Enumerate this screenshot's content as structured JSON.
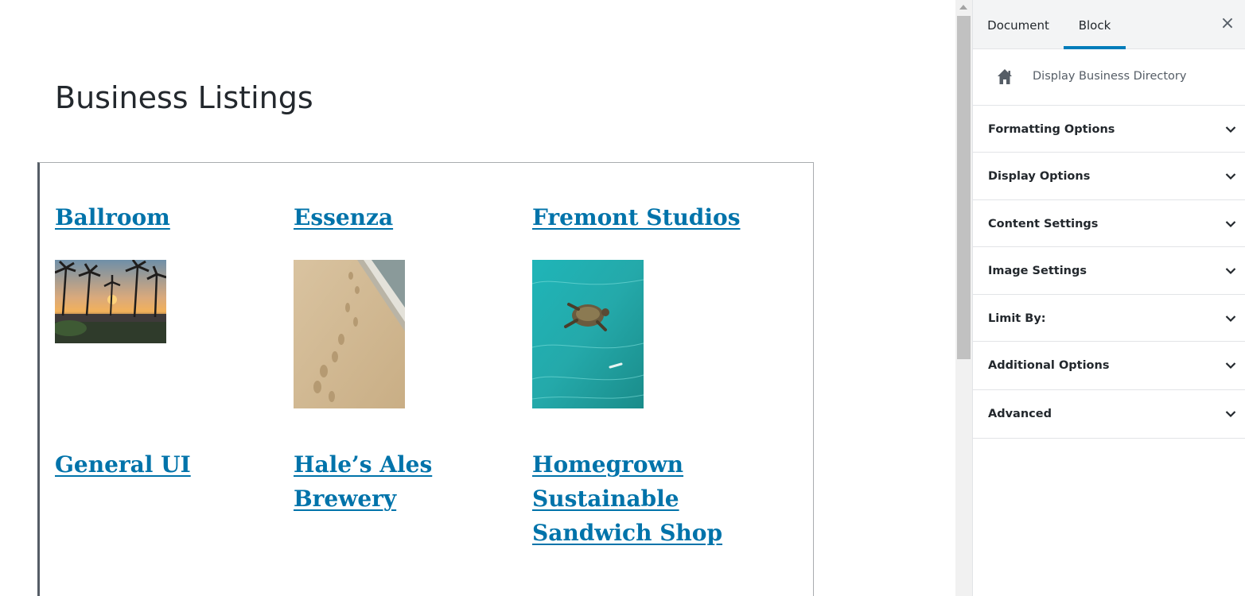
{
  "editor": {
    "title": "Business Listings",
    "listings": [
      {
        "name": "Ballroom",
        "image": "palm-sunset-photo"
      },
      {
        "name": "Essenza",
        "image": "beach-footprints-photo"
      },
      {
        "name": "Fremont Studios",
        "image": "sea-turtle-photo"
      },
      {
        "name": "General UI"
      },
      {
        "name": "Hale’s Ales Brewery"
      },
      {
        "name": "Homegrown Sustainable Sandwich Shop"
      }
    ]
  },
  "sidebar": {
    "tabs": [
      {
        "label": "Document",
        "active": false
      },
      {
        "label": "Block",
        "active": true
      }
    ],
    "close_label": "×",
    "block_card": {
      "icon": "home-icon",
      "title": "Display Business Directory"
    },
    "panels": [
      {
        "label": "Formatting Options"
      },
      {
        "label": "Display Options"
      },
      {
        "label": "Content Settings"
      },
      {
        "label": "Image Settings"
      },
      {
        "label": "Limit By:"
      },
      {
        "label": "Additional Options"
      },
      {
        "label": "Advanced"
      }
    ]
  },
  "colors": {
    "link": "#0073aa",
    "accent": "#007cba",
    "text": "#23282d",
    "muted": "#555d66"
  }
}
